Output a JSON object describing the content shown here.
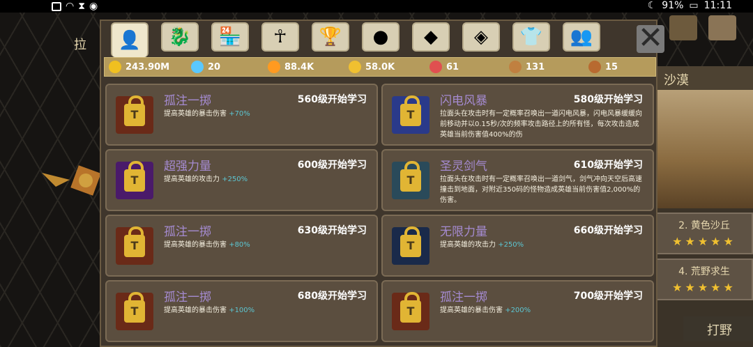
{
  "statusbar": {
    "battery": "91%",
    "time": "11:11"
  },
  "left_badge": "拉",
  "tabs": [
    {
      "icon": "person-icon",
      "glyph": "👤"
    },
    {
      "icon": "dragon-head-icon",
      "glyph": "🐉"
    },
    {
      "icon": "shop-icon",
      "glyph": "🏪"
    },
    {
      "icon": "ankh-icon",
      "glyph": "☥"
    },
    {
      "icon": "trophy-icon",
      "glyph": "🏆"
    },
    {
      "icon": "orb-icon",
      "glyph": "●"
    },
    {
      "icon": "winged-gem-icon",
      "glyph": "◆"
    },
    {
      "icon": "crystal-icon",
      "glyph": "◈"
    },
    {
      "icon": "shirt-icon",
      "glyph": "👕"
    },
    {
      "icon": "friends-icon",
      "glyph": "👥"
    }
  ],
  "resources": [
    {
      "icon": "gold-coin-icon",
      "value": "243.90M",
      "color": "#f0c020"
    },
    {
      "icon": "diamond-icon",
      "value": "20",
      "color": "#5ac8ff"
    },
    {
      "icon": "orange-orb-icon",
      "value": "88.4K",
      "color": "#ff9a20"
    },
    {
      "icon": "spark-icon",
      "value": "58.0K",
      "color": "#f0c030"
    },
    {
      "icon": "red-crystal-icon",
      "value": "61",
      "color": "#e05050"
    },
    {
      "icon": "chest-icon",
      "value": "131",
      "color": "#c08040"
    },
    {
      "icon": "bread-icon",
      "value": "15",
      "color": "#b86a30"
    }
  ],
  "skills": [
    {
      "name": "孤注一掷",
      "level": "560级开始学习",
      "desc": "提高英雄的暴击伤害",
      "bonus": "+70%"
    },
    {
      "name": "闪电风暴",
      "level": "580级开始学习",
      "desc": "拉面头在攻击时有一定概率召唤出一道闪电风暴，闪电风暴缓缓向前移动并以0.15秒/次的频率攻击路径上的所有怪，每次攻击造成英雄当前伤害值400%的伤",
      "bonus": ""
    },
    {
      "name": "超强力量",
      "level": "600级开始学习",
      "desc": "提高英雄的攻击力",
      "bonus": "+250%"
    },
    {
      "name": "圣灵剑气",
      "level": "610级开始学习",
      "desc": "拉面头在攻击时有一定概率召唤出一道剑气，剑气冲向天空后高速撞击到地面，对附近350码的怪物造成英雄当前伤害值2,000%的伤害。",
      "bonus": ""
    },
    {
      "name": "孤注一掷",
      "level": "630级开始学习",
      "desc": "提高英雄的暴击伤害",
      "bonus": "+80%"
    },
    {
      "name": "无限力量",
      "level": "660级开始学习",
      "desc": "提高英雄的攻击力",
      "bonus": "+250%"
    },
    {
      "name": "孤注一掷",
      "level": "680级开始学习",
      "desc": "提高英雄的暴击伤害",
      "bonus": "+100%"
    },
    {
      "name": "孤注一掷",
      "level": "700级开始学习",
      "desc": "提高英雄的暴击伤害",
      "bonus": "+200%"
    }
  ],
  "right_panel": {
    "title": "沙漠",
    "levels": [
      {
        "label": "2. 黄色沙丘",
        "stars": "★★★★★"
      },
      {
        "label": "4. 荒野求生",
        "stars": "★★★★★"
      }
    ],
    "fight_label": "打野"
  }
}
